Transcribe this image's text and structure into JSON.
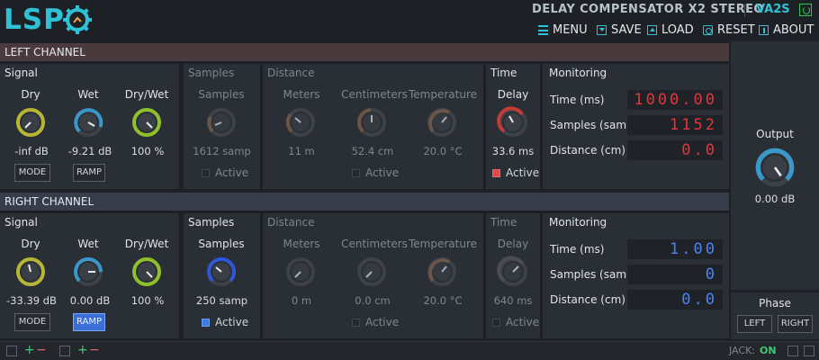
{
  "header": {
    "logo": "LSP",
    "title": "DELAY COMPENSATOR X2 STEREO",
    "variant": "VA2S",
    "menu": [
      {
        "label": "MENU",
        "icon": "menu-icon"
      },
      {
        "label": "SAVE",
        "icon": "save-icon"
      },
      {
        "label": "LOAD",
        "icon": "load-icon"
      },
      {
        "label": "RESET",
        "icon": "reset-icon"
      },
      {
        "label": "ABOUT",
        "icon": "about-icon"
      }
    ]
  },
  "colors": {
    "accent": "#2fc1d8",
    "red": "#e2343d",
    "blue": "#4a84f2",
    "knob_yellow": "#b7b536",
    "knob_green": "#8fbf2a",
    "knob_cyan": "#3a98c9"
  },
  "left": {
    "title": "LEFT CHANNEL",
    "signal": {
      "header": "Signal",
      "dry_label": "Dry",
      "wet_label": "Wet",
      "drywet_label": "Dry/Wet",
      "dry_value": "-inf dB",
      "wet_value": "-9.21 dB",
      "drywet_value": "100 %",
      "mode_label": "MODE",
      "ramp_label": "RAMP"
    },
    "samples": {
      "header": "Samples",
      "label": "Samples",
      "value": "1612 samp",
      "active_label": "Active"
    },
    "distance": {
      "header": "Distance",
      "meters_label": "Meters",
      "cm_label": "Centimeters",
      "temp_label": "Temperature",
      "meters_value": "11 m",
      "cm_value": "52.4 cm",
      "temp_value": "20.0 °C",
      "active_label": "Active"
    },
    "time": {
      "header": "Time",
      "label": "Delay",
      "value": "33.6 ms",
      "active_label": "Active"
    },
    "monitoring": {
      "header": "Monitoring",
      "time_label": "Time (ms)",
      "time_value": "1000.00",
      "samples_label": "Samples (samp)",
      "samples_value": "1152",
      "distance_label": "Distance (cm)",
      "distance_value": "0.0"
    }
  },
  "right": {
    "title": "RIGHT CHANNEL",
    "signal": {
      "header": "Signal",
      "dry_label": "Dry",
      "wet_label": "Wet",
      "drywet_label": "Dry/Wet",
      "dry_value": "-33.39 dB",
      "wet_value": "0.00 dB",
      "drywet_value": "100 %",
      "mode_label": "MODE",
      "ramp_label": "RAMP"
    },
    "samples": {
      "header": "Samples",
      "label": "Samples",
      "value": "250 samp",
      "active_label": "Active"
    },
    "distance": {
      "header": "Distance",
      "meters_label": "Meters",
      "cm_label": "Centimeters",
      "temp_label": "Temperature",
      "meters_value": "0 m",
      "cm_value": "0.0 cm",
      "temp_value": "20.0 °C",
      "active_label": "Active"
    },
    "time": {
      "header": "Time",
      "label": "Delay",
      "value": "640 ms",
      "active_label": "Active"
    },
    "monitoring": {
      "header": "Monitoring",
      "time_label": "Time (ms)",
      "time_value": "1.00",
      "samples_label": "Samples (samp)",
      "samples_value": "0",
      "distance_label": "Distance (cm)",
      "distance_value": "0.0"
    }
  },
  "output": {
    "label": "Output",
    "value": "0.00 dB"
  },
  "phase": {
    "label": "Phase",
    "left_label": "LEFT",
    "right_label": "RIGHT"
  },
  "status": {
    "jack_label": "JACK:",
    "jack_state": "ON"
  }
}
